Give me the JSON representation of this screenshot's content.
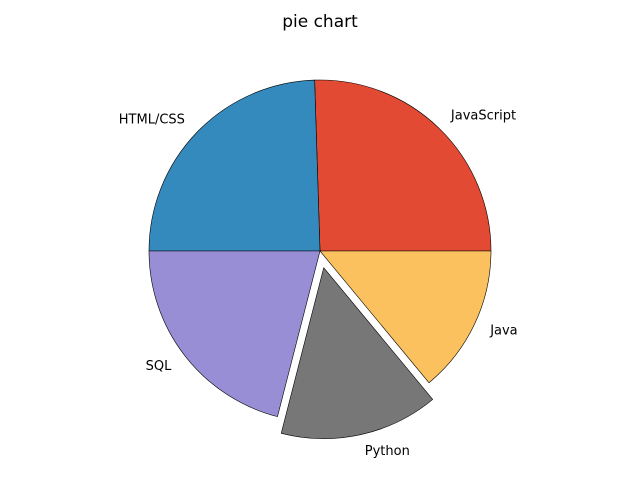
{
  "chart_data": {
    "type": "pie",
    "title": "pie chart",
    "start_angle_deg": 0,
    "direction": "counterclockwise",
    "slices": [
      {
        "label": "JavaScript",
        "value": 25.5,
        "color": "#E24A33",
        "explode": 0
      },
      {
        "label": "HTML/CSS",
        "value": 24.5,
        "color": "#348ABD",
        "explode": 0
      },
      {
        "label": "SQL",
        "value": 21.0,
        "color": "#988ED5",
        "explode": 0
      },
      {
        "label": "Python",
        "value": 15.0,
        "color": "#777777",
        "explode": 0.1
      },
      {
        "label": "Java",
        "value": 14.0,
        "color": "#FBC15E",
        "explode": 0
      }
    ],
    "edge_color": "#000000",
    "legend": "none"
  }
}
